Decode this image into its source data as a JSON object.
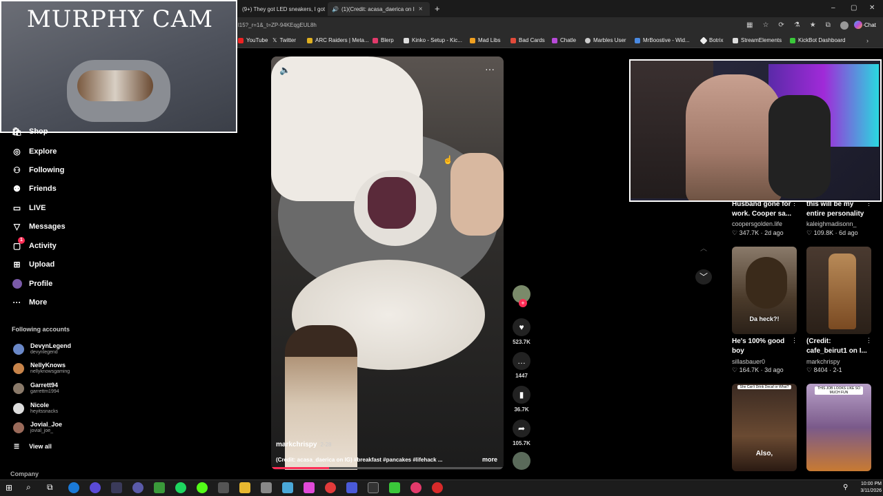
{
  "browser": {
    "tabs": [
      {
        "label": "(9+) They got LED sneakers, I got"
      },
      {
        "label": "(1)(Credit: acasa_daerica on I"
      }
    ],
    "url": "l15?_r=1&_t=ZP-94KEqgEUL8h",
    "bookmarks": [
      "YouTube",
      "Twitter",
      "ARC Raiders | Meta...",
      "Blerp",
      "Kinko - Setup - Kic...",
      "Mad Libs",
      "Bad Cards",
      "Chatle",
      "Marbles User",
      "MrBoostive - Wid...",
      "Botrix",
      "StreamElements",
      "KickBot Dashboard"
    ],
    "chat_label": "Chat"
  },
  "overlay": {
    "cam_title": "MURPHY CAM"
  },
  "sidebar": {
    "items": [
      {
        "label": "Shop",
        "icon": "shop-icon"
      },
      {
        "label": "Explore",
        "icon": "compass-icon"
      },
      {
        "label": "Following",
        "icon": "following-icon"
      },
      {
        "label": "Friends",
        "icon": "friends-icon"
      },
      {
        "label": "LIVE",
        "icon": "live-icon"
      },
      {
        "label": "Messages",
        "icon": "messages-icon"
      },
      {
        "label": "Activity",
        "icon": "activity-icon",
        "badge": "1"
      },
      {
        "label": "Upload",
        "icon": "upload-icon"
      },
      {
        "label": "Profile",
        "icon": "profile-icon"
      },
      {
        "label": "More",
        "icon": "more-icon"
      }
    ],
    "following_header": "Following accounts",
    "accounts": [
      {
        "name": "DevynLegend",
        "handle": "devynlegend",
        "color": "#6a88c8"
      },
      {
        "name": "NellyKnows",
        "handle": "nellyknowsgaming",
        "color": "#c8844a"
      },
      {
        "name": "Garrett94",
        "handle": "garrettm1994",
        "color": "#8a7a6a"
      },
      {
        "name": "Nicole",
        "handle": "heyitssnacks",
        "color": "#dddddd"
      },
      {
        "name": "Jovial_Joe",
        "handle": "jovial_joe_",
        "color": "#9a6a5a"
      }
    ],
    "view_all": "View all",
    "company": "Company"
  },
  "video": {
    "author": "markchrispy",
    "age": "2-28",
    "caption": "(Credit: acasa_daerica on IG) #breakfast #pancakes #lifehack ...",
    "more": "more",
    "likes": "523.7K",
    "comments": "1447",
    "saves": "36.7K",
    "shares": "105.7K"
  },
  "feed": [
    {
      "title": "Husband gone for work. Cooper sa...",
      "author": "coopersgolden.life",
      "stats": "347.7K · 2d ago"
    },
    {
      "title": "this will be my entire personality",
      "author": "kaleighmadisonn_",
      "stats": "109.8K · 6d ago"
    },
    {
      "title": "He's 100% good boy",
      "author": "sillasbauer0",
      "stats": "164.7K · 3d ago",
      "overlay": "Da heck?!"
    },
    {
      "title": "(Credit: cafe_beirut1 on I...",
      "author": "markchrispy",
      "stats": "8404 · 2-1"
    },
    {
      "overlay": "Also,",
      "caption": "She Can't Drink Decaf or What?"
    },
    {
      "caption": "THIS JOB LOOKS LIKE SO MUCH FUN"
    }
  ],
  "taskbar": {
    "time": "10:00 PM",
    "date": "3/11/2026"
  }
}
